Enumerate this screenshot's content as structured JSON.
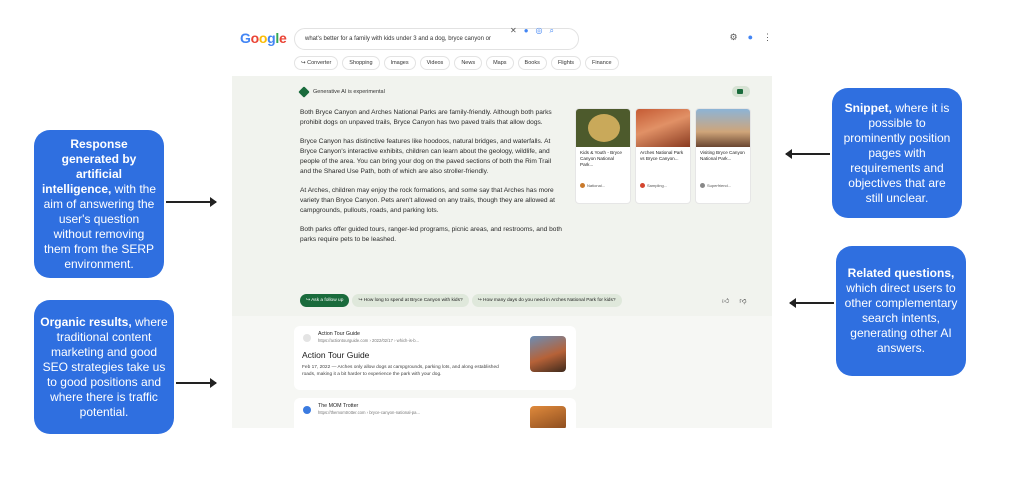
{
  "search": {
    "query": "what's better for a family with kids under 3 and a dog, bryce canyon or",
    "logo": [
      "G",
      "o",
      "o",
      "g",
      "l",
      "e"
    ]
  },
  "chips": [
    "Converter",
    "Shopping",
    "Images",
    "Videos",
    "News",
    "Maps",
    "Books",
    "Flights",
    "Finance"
  ],
  "ai_overview": {
    "header": "Generative AI is experimental",
    "paragraphs": [
      "Both Bryce Canyon and Arches National Parks are family-friendly. Although both parks prohibit dogs on unpaved trails, Bryce Canyon has two paved trails that allow dogs.",
      "Bryce Canyon has distinctive features like hoodoos, natural bridges, and waterfalls. At Bryce Canyon's interactive exhibits, children can learn about the geology, wildlife, and people of the area. You can bring your dog on the paved sections of both the Rim Trail and the Shared Use Path, both of which are also stroller-friendly.",
      "At Arches, children may enjoy the rock formations, and some say that Arches has more variety than Bryce Canyon. Pets aren't allowed on any trails, though they are allowed at campgrounds, pullouts, roads, and parking lots.",
      "Both parks offer guided tours, ranger-led programs, picnic areas, and restrooms, and both parks require pets to be leashed."
    ],
    "cards": [
      {
        "title": "Kids & Youth - Bryce Canyon National Park...",
        "source": "National..."
      },
      {
        "title": "Arches National Park vs Bryce Canyon...",
        "source": "Sampling..."
      },
      {
        "title": "Visiting Bryce Canyon National Park...",
        "source": "Superfriend..."
      }
    ],
    "followups": [
      "Ask a follow up",
      "How long to spend at Bryce Canyon with kids?",
      "How many days do you need in Arches National Park for kids?"
    ]
  },
  "organic": [
    {
      "site": "Action Tour Guide",
      "url": "https://actiontourguide.com › 2022/02/17 › which-is-b...",
      "title": "Action Tour Guide",
      "snippet": "Feb 17, 2022 — Arches only allow dogs at campgrounds, parking lots, and along established roads, making it a bit harder to experience the park with your dog."
    },
    {
      "site": "The MOM Trotter",
      "url": "https://themomtrotter.com › bryce-canyon-national-pa..."
    }
  ],
  "callouts": {
    "response": {
      "bold": "Response generated by artificial intelligence,",
      "rest": " with the aim of answering the user's question without removing them from the SERP environment."
    },
    "organic": {
      "bold": "Organic results,",
      "rest": " where traditional content marketing and good SEO strategies take us to good positions and where there is traffic potential."
    },
    "snippet": {
      "bold": "Snippet,",
      "rest": " where it is possible to prominently position pages with requirements and objectives that are still unclear."
    },
    "related": {
      "bold": "Related questions,",
      "rest": " which direct users to other complementary search intents, generating other AI answers."
    }
  }
}
